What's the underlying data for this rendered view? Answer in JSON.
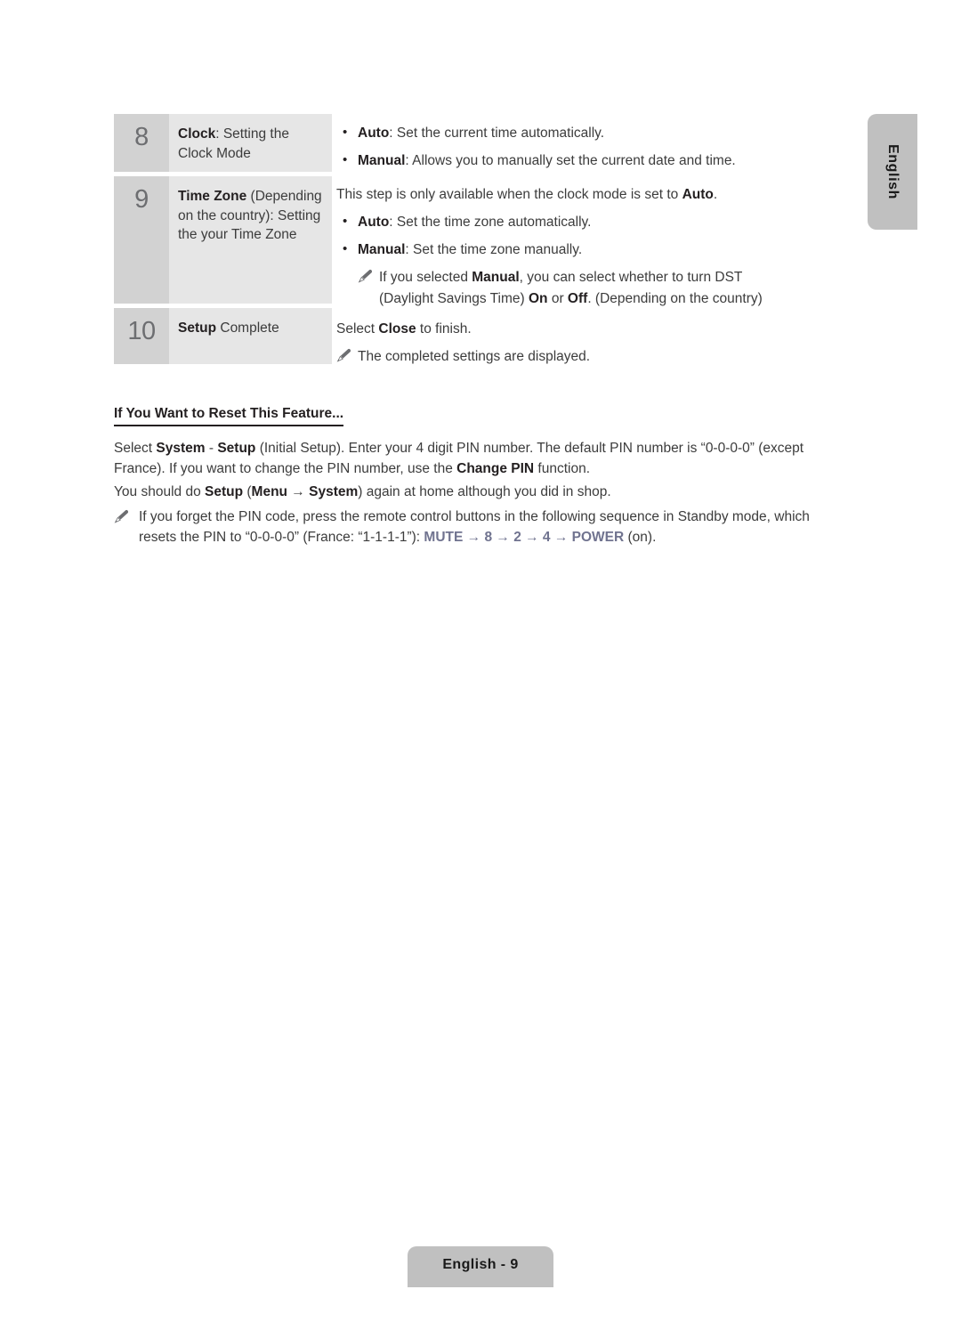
{
  "side_tab": {
    "label": "English"
  },
  "footer": {
    "label": "English - 9"
  },
  "icons": {
    "pencil": "pencil-icon",
    "bullet": "bullet-dot",
    "arrow": "→"
  },
  "colors": {
    "accent_remote_key": "#70738f",
    "table_number_bg": "#d2d2d2",
    "table_label_bg": "#e6e6e6",
    "tab_bg": "#c0c0c0",
    "body_text": "#3c3c3c",
    "bold_text": "#231f20"
  },
  "steps": [
    {
      "number": "8",
      "label_html": "<b>Clock</b>: Setting the Clock Mode",
      "label_bold": "Clock",
      "label_rest": ": Setting the Clock Mode",
      "description_lines": [
        {
          "kind": "bullet",
          "bold": "Auto",
          "rest": ": Set the current time automatically."
        },
        {
          "kind": "bullet",
          "bold": "Manual",
          "rest": ": Allows you to manually set the current date and time."
        }
      ]
    },
    {
      "number": "9",
      "label_bold": "Time Zone",
      "label_rest": " (Depending on the country): Setting the your Time Zone",
      "description_lines": [
        {
          "kind": "plain",
          "text_before": "This step is only available when the clock mode is set to ",
          "bold": "Auto",
          "text_after": "."
        },
        {
          "kind": "bullet",
          "bold": "Auto",
          "rest": ": Set the time zone automatically."
        },
        {
          "kind": "bullet",
          "bold": "Manual",
          "rest": ": Set the time zone manually."
        },
        {
          "kind": "note",
          "line1_a": "If you selected ",
          "line1_b": "Manual",
          "line1_c": ", you can select whether to turn DST",
          "line2_a": "(Daylight Savings Time) ",
          "line2_b": "On",
          "line2_c": " or ",
          "line2_d": "Off",
          "line2_e": ". (Depending on the country)"
        }
      ]
    },
    {
      "number": "10",
      "label_bold": "Setup",
      "label_rest": " Complete",
      "description_lines": [
        {
          "kind": "plain",
          "text_before": "Select ",
          "bold": "Close",
          "text_after": " to finish."
        },
        {
          "kind": "note_simple",
          "text": "The completed settings are displayed."
        }
      ]
    }
  ],
  "section": {
    "heading": "If You Want to Reset This Feature...",
    "paragraph_1": {
      "p1": "Select ",
      "b1": "System",
      "p2": " - ",
      "b2": "Setup",
      "p3": " (Initial Setup). Enter your 4 digit PIN number. The default PIN number is “0-0-0-0” (except France). If you want to change the PIN number, use the ",
      "b3": "Change PIN",
      "p4": " function."
    },
    "paragraph_2": {
      "p1": "You should do ",
      "b1": "Setup",
      "p2": " (",
      "b2": "Menu",
      "p3": " → ",
      "b3": "System",
      "p4": ") again at home although you did in shop."
    },
    "note": {
      "p1": "If you forget the PIN code, press the remote control buttons in the following sequence in Standby mode, which resets the PIN to “0-0-0-0” (France: “1-1-1-1”): ",
      "key1": "MUTE",
      "s1": " → 8 → 2 → 4 → ",
      "key2": "POWER",
      "p2": " (on)."
    }
  }
}
